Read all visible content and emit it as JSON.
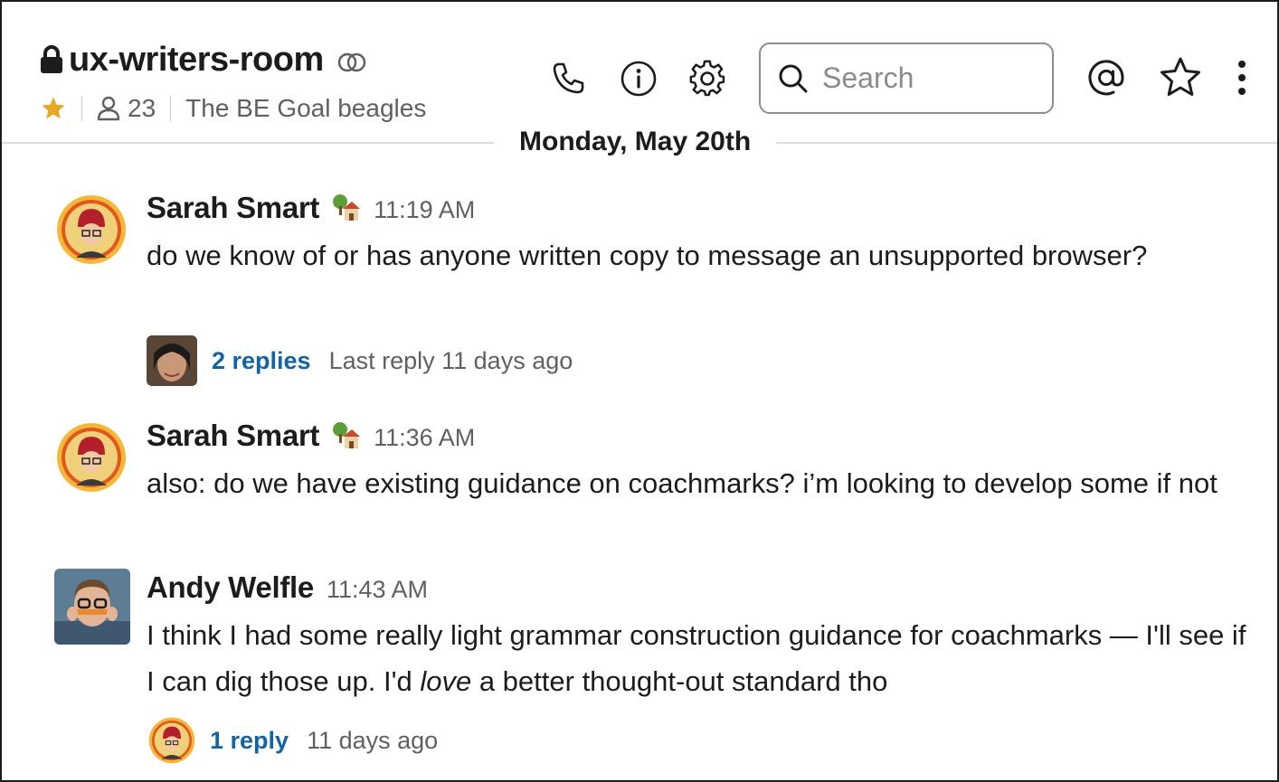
{
  "channel": {
    "name": "ux-writers-room",
    "member_count": "23",
    "topic": "The BE Goal beagles"
  },
  "toolbar": {
    "call_icon": "phone-icon",
    "info_icon": "info-icon",
    "settings_icon": "gear-icon",
    "mentions_icon": "at-icon",
    "star_icon": "star-icon",
    "more_icon": "vertical-ellipsis-icon"
  },
  "search": {
    "placeholder": "Search"
  },
  "date_divider": "Monday, May 20th",
  "messages": [
    {
      "author": "Sarah Smart",
      "status_emoji": "house-with-tree-icon",
      "time": "11:19 AM",
      "text": "do we know of or has anyone written copy to message an unsupported browser?",
      "thread": {
        "replies": "2 replies",
        "meta": "Last reply 11 days ago"
      }
    },
    {
      "author": "Sarah Smart",
      "status_emoji": "house-with-tree-icon",
      "time": "11:36 AM",
      "text": "also: do we have existing guidance on coachmarks? i’m looking to develop some if not"
    },
    {
      "author": "Andy Welfle",
      "time": "11:43 AM",
      "text_before": "I think I had some really light grammar construction guidance for coachmarks — I'll see if I can dig those up. I'd ",
      "text_emphasis": "love",
      "text_after": " a better thought-out standard tho",
      "thread": {
        "replies": "1 reply",
        "meta": "11 days ago"
      }
    }
  ],
  "colors": {
    "link": "#1264a3",
    "star": "#e8a723",
    "muted": "#616061"
  }
}
